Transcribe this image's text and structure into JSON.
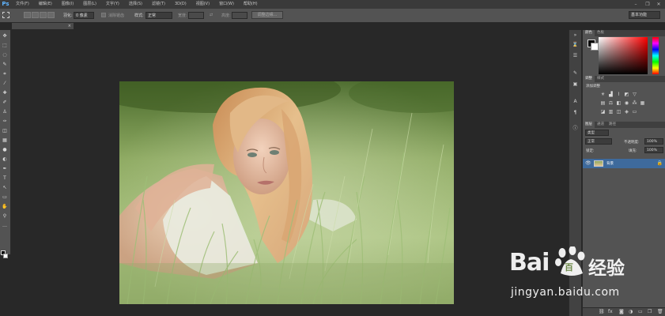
{
  "app": {
    "logo": "Ps"
  },
  "menubar": {
    "items": [
      "文件(F)",
      "编辑(E)",
      "图像(I)",
      "图层(L)",
      "文字(Y)",
      "选择(S)",
      "滤镜(T)",
      "3D(D)",
      "视图(V)",
      "窗口(W)",
      "帮助(H)"
    ]
  },
  "window_controls": {
    "minimize": "–",
    "restore": "❐",
    "close": "✕"
  },
  "options_bar": {
    "feather_label": "羽化:",
    "feather_value": "0 像素",
    "antialias_label": "消除锯齿",
    "style_label": "样式:",
    "style_value": "正常",
    "width_label": "宽度:",
    "height_label": "高度:",
    "refine_edge_label": "调整边缘...",
    "workspace": "基本功能"
  },
  "document": {
    "tab_title": "",
    "close": "×"
  },
  "panels": {
    "color_tabs": [
      "颜色",
      "色板"
    ],
    "adjust_tabs": [
      "调整",
      "样式"
    ],
    "adjust_title": "添加调整",
    "layer_tabs": [
      "图层",
      "通道",
      "路径"
    ],
    "kind_filter": "类型",
    "blend_mode": "正常",
    "opacity_label": "不透明度:",
    "opacity_value": "100%",
    "lock_label": "锁定:",
    "fill_label": "填充:",
    "fill_value": "100%",
    "layers": [
      {
        "name": "背景",
        "visible": true,
        "locked": true
      }
    ]
  },
  "watermark": {
    "logo_text": "Bai",
    "logo_text_2": "百",
    "brand_cn": "经验",
    "url": "jingyan.baidu.com"
  },
  "colors": {
    "menubar": "#3a3a3a",
    "panel": "#535353",
    "canvas_bg": "#282828",
    "layer_selected": "#3e6a9c",
    "ps_blue": "#5fb4ff"
  }
}
